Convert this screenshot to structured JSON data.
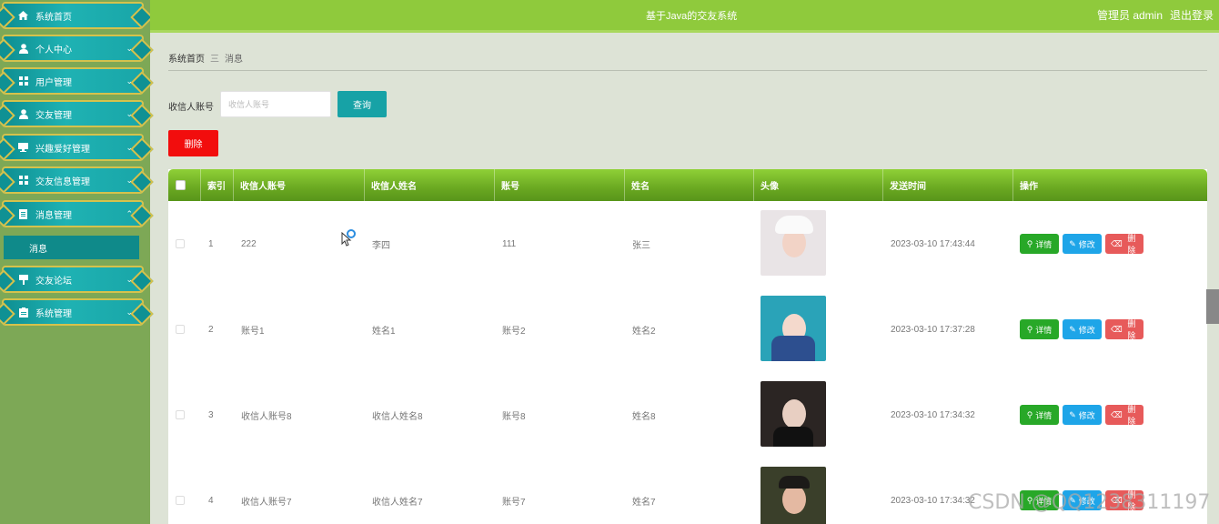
{
  "sidebar": {
    "items": [
      {
        "label": "系统首页",
        "icon": "home-icon",
        "chevron": ""
      },
      {
        "label": "个人中心",
        "icon": "user-icon",
        "chevron": "⌄"
      },
      {
        "label": "用户管理",
        "icon": "grid-icon",
        "chevron": "⌄"
      },
      {
        "label": "交友管理",
        "icon": "user-icon",
        "chevron": "⌄"
      },
      {
        "label": "兴趣爱好管理",
        "icon": "monitor-icon",
        "chevron": "⌄"
      },
      {
        "label": "交友信息管理",
        "icon": "grid-icon",
        "chevron": "⌄"
      },
      {
        "label": "消息管理",
        "icon": "document-icon",
        "chevron": "⌃"
      },
      {
        "label": "交友论坛",
        "icon": "forum-icon",
        "chevron": "⌄"
      },
      {
        "label": "系统管理",
        "icon": "clipboard-icon",
        "chevron": "⌄"
      }
    ],
    "submenu": {
      "label": "消息"
    }
  },
  "header": {
    "title": "基于Java的交友系统",
    "admin": "管理员 admin",
    "logout": "退出登录"
  },
  "breadcrumb": {
    "home": "系统首页",
    "separator": "三",
    "current": "消息"
  },
  "search": {
    "label": "收信人账号",
    "placeholder": "收信人账号",
    "button": "查询"
  },
  "actions": {
    "delete": "删除"
  },
  "table": {
    "headers": [
      "索引",
      "收信人账号",
      "收信人姓名",
      "账号",
      "姓名",
      "头像",
      "发送时间",
      "操作"
    ],
    "rows": [
      {
        "index": "1",
        "recipient_account": "222",
        "recipient_name": "李四",
        "account": "111",
        "name": "张三",
        "time": "2023-03-10 17:43:44"
      },
      {
        "index": "2",
        "recipient_account": "账号1",
        "recipient_name": "姓名1",
        "account": "账号2",
        "name": "姓名2",
        "time": "2023-03-10 17:37:28"
      },
      {
        "index": "3",
        "recipient_account": "收信人账号8",
        "recipient_name": "收信人姓名8",
        "account": "账号8",
        "name": "姓名8",
        "time": "2023-03-10 17:34:32"
      },
      {
        "index": "4",
        "recipient_account": "收信人账号7",
        "recipient_name": "收信人姓名7",
        "account": "账号7",
        "name": "姓名7",
        "time": "2023-03-10 17:34:32"
      }
    ],
    "ops": {
      "detail": "详情",
      "edit": "修改",
      "delete": "删除"
    }
  },
  "watermark": "CSDN @QQ1238311197",
  "colors": {
    "topbar": "#8fca3c",
    "sidebar": "#7da856",
    "menu": "#1aa9aa",
    "menu_border": "#d5c24c",
    "header_row": "#6aa821",
    "query": "#17a2a6",
    "delete": "#f20d0d",
    "detail": "#28a828",
    "edit": "#1ea5e8",
    "row_delete": "#e75a5a"
  }
}
